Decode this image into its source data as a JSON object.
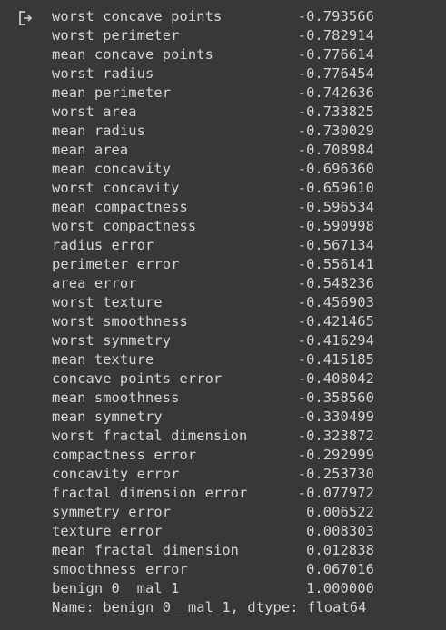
{
  "output": {
    "icon": "output-redirect-icon",
    "rows": [
      {
        "feature": "worst concave points",
        "value": "-0.793566"
      },
      {
        "feature": "worst perimeter",
        "value": "-0.782914"
      },
      {
        "feature": "mean concave points",
        "value": "-0.776614"
      },
      {
        "feature": "worst radius",
        "value": "-0.776454"
      },
      {
        "feature": "mean perimeter",
        "value": "-0.742636"
      },
      {
        "feature": "worst area",
        "value": "-0.733825"
      },
      {
        "feature": "mean radius",
        "value": "-0.730029"
      },
      {
        "feature": "mean area",
        "value": "-0.708984"
      },
      {
        "feature": "mean concavity",
        "value": "-0.696360"
      },
      {
        "feature": "worst concavity",
        "value": "-0.659610"
      },
      {
        "feature": "mean compactness",
        "value": "-0.596534"
      },
      {
        "feature": "worst compactness",
        "value": "-0.590998"
      },
      {
        "feature": "radius error",
        "value": "-0.567134"
      },
      {
        "feature": "perimeter error",
        "value": "-0.556141"
      },
      {
        "feature": "area error",
        "value": "-0.548236"
      },
      {
        "feature": "worst texture",
        "value": "-0.456903"
      },
      {
        "feature": "worst smoothness",
        "value": "-0.421465"
      },
      {
        "feature": "worst symmetry",
        "value": "-0.416294"
      },
      {
        "feature": "mean texture",
        "value": "-0.415185"
      },
      {
        "feature": "concave points error",
        "value": "-0.408042"
      },
      {
        "feature": "mean smoothness",
        "value": "-0.358560"
      },
      {
        "feature": "mean symmetry",
        "value": "-0.330499"
      },
      {
        "feature": "worst fractal dimension",
        "value": "-0.323872"
      },
      {
        "feature": "compactness error",
        "value": "-0.292999"
      },
      {
        "feature": "concavity error",
        "value": "-0.253730"
      },
      {
        "feature": "fractal dimension error",
        "value": "-0.077972"
      },
      {
        "feature": "symmetry error",
        "value": "0.006522"
      },
      {
        "feature": "texture error",
        "value": "0.008303"
      },
      {
        "feature": "mean fractal dimension",
        "value": "0.012838"
      },
      {
        "feature": "smoothness error",
        "value": "0.067016"
      },
      {
        "feature": "benign_0__mal_1",
        "value": "1.000000"
      }
    ],
    "footer": "Name: benign_0__mal_1, dtype: float64"
  },
  "colors": {
    "background": "#383838",
    "text": "#d5d5d5",
    "icon": "#c8c8c8"
  }
}
